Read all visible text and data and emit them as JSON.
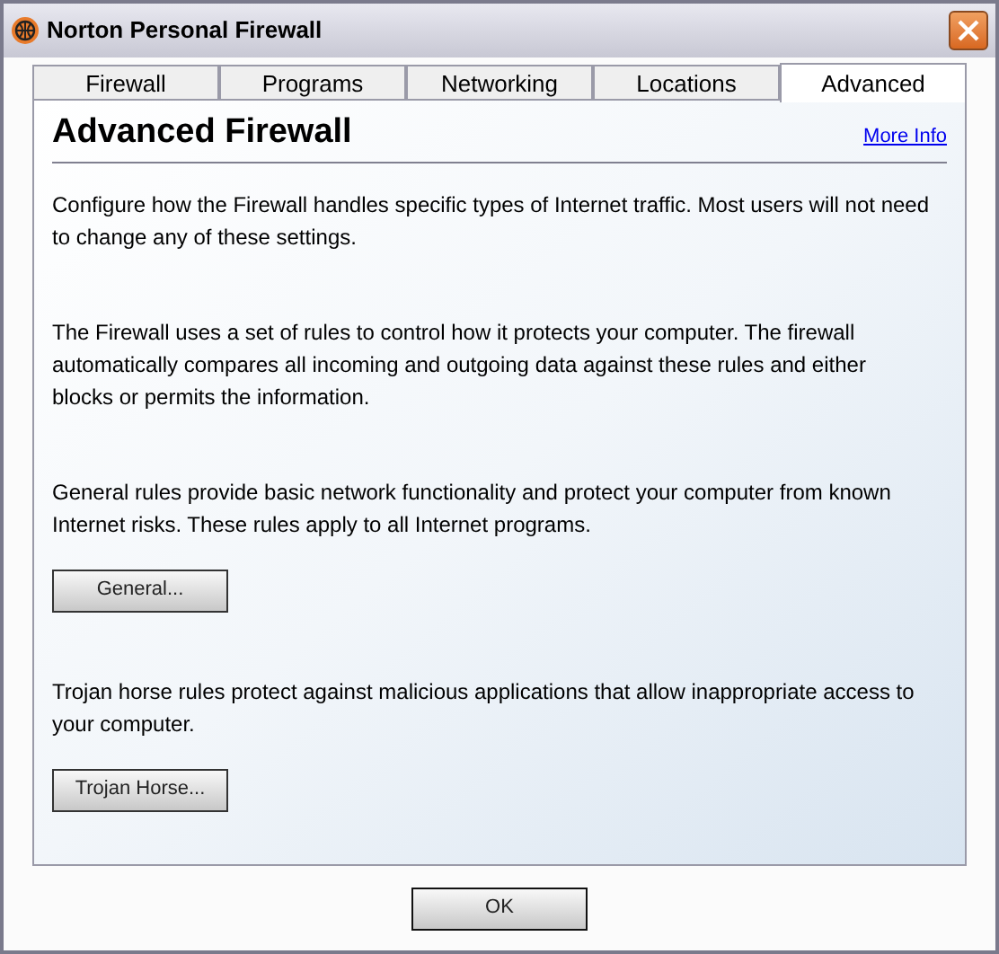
{
  "window": {
    "title": "Norton Personal Firewall"
  },
  "tabs": [
    {
      "label": "Firewall",
      "selected": false
    },
    {
      "label": "Programs",
      "selected": false
    },
    {
      "label": "Networking",
      "selected": false
    },
    {
      "label": "Locations",
      "selected": false
    },
    {
      "label": "Advanced",
      "selected": true
    }
  ],
  "page": {
    "heading": "Advanced Firewall",
    "link": "More Info",
    "sections": [
      {
        "text": "Configure how the Firewall handles specific types of Internet traffic. Most users will not need to change any of these settings."
      },
      {
        "text": "The Firewall uses a set of rules to control how it protects your computer. The firewall automatically compares all incoming and outgoing data against these rules and either blocks or permits the information."
      },
      {
        "text": "General rules provide basic network functionality and protect your computer from known Internet risks. These rules apply to all Internet programs.",
        "button": "General..."
      },
      {
        "text": "Trojan horse rules protect against malicious applications that allow inappropriate access to your computer.",
        "button": "Trojan Horse..."
      }
    ]
  },
  "buttons": [
    "OK"
  ]
}
